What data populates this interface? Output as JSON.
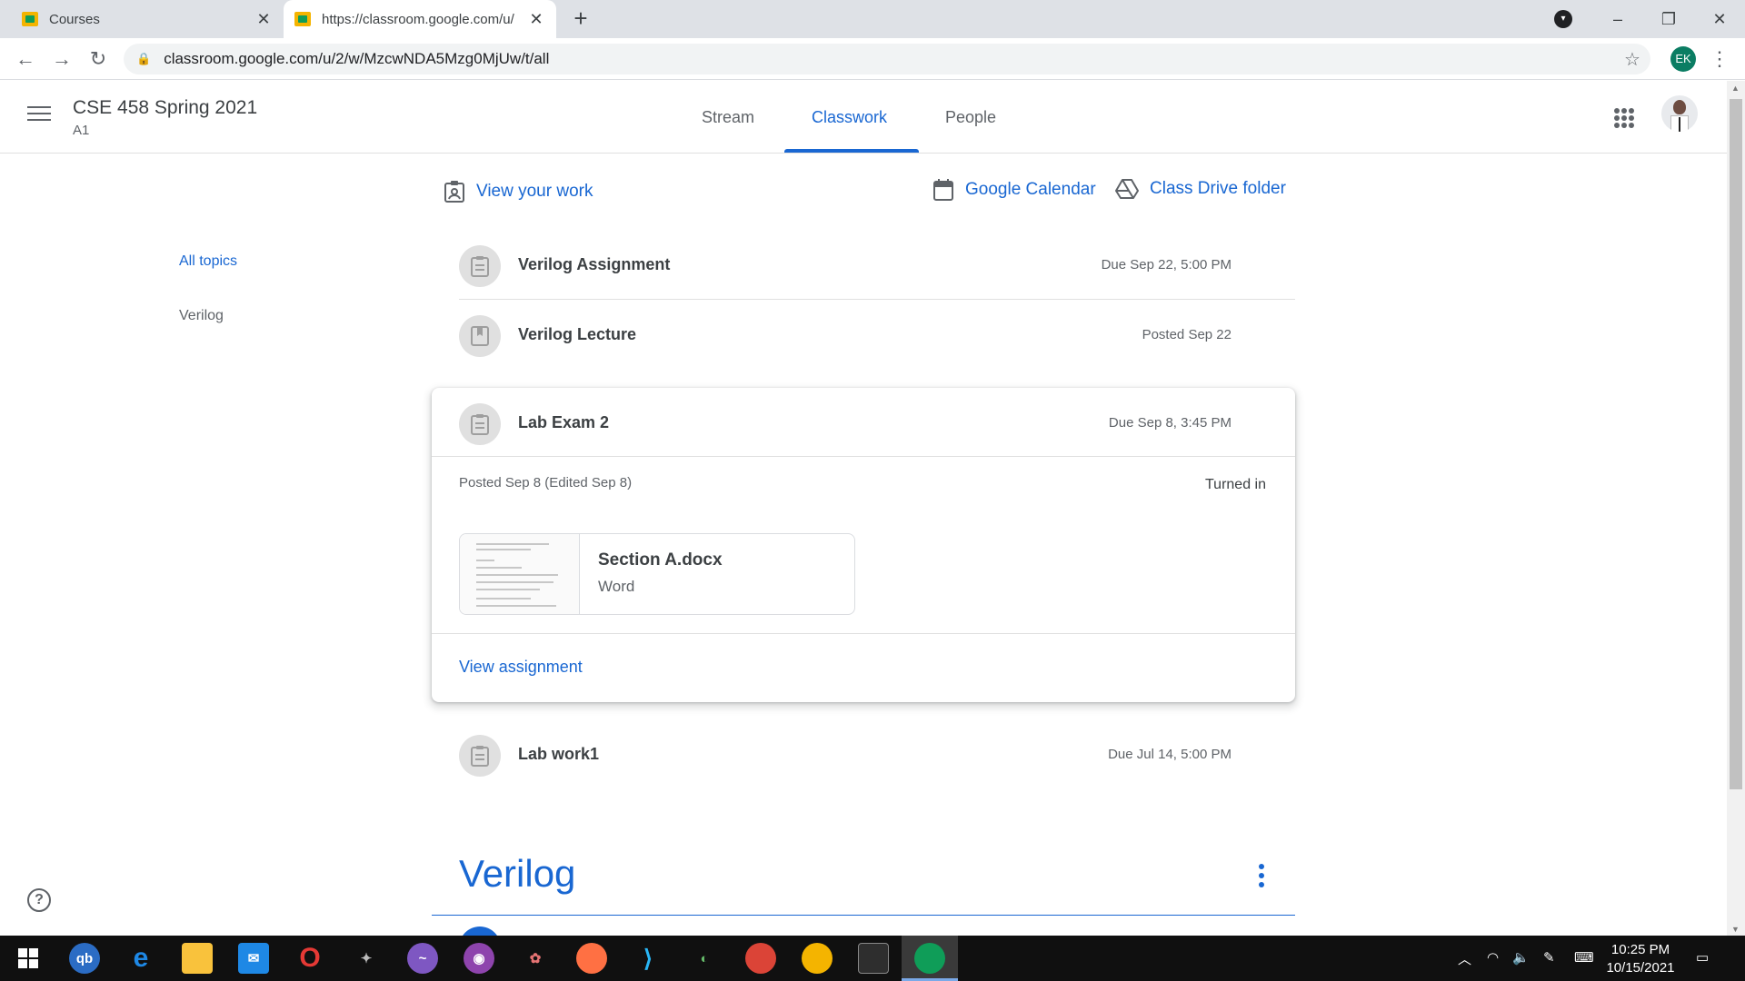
{
  "browser": {
    "tabs": [
      {
        "title": "Courses"
      },
      {
        "title": "https://classroom.google.com/u/"
      }
    ],
    "new_tab": "+",
    "url": "classroom.google.com/u/2/w/MzcwNDA5Mzg0MjUw/t/all",
    "profile_initials": "EK",
    "window_controls": [
      "–",
      "❐",
      "✕"
    ]
  },
  "course": {
    "title": "CSE 458 Spring 2021",
    "section": "A1"
  },
  "nav_tabs": [
    {
      "label": "Stream",
      "active": false
    },
    {
      "label": "Classwork",
      "active": true
    },
    {
      "label": "People",
      "active": false
    }
  ],
  "topics": {
    "all": "All topics",
    "items": [
      "Verilog"
    ]
  },
  "links": {
    "view_work": "View your work",
    "calendar": "Google Calendar",
    "drive": "Class Drive folder"
  },
  "items": [
    {
      "title": "Verilog Assignment",
      "date": "Due Sep 22, 5:00 PM",
      "icon": "assignment-icon"
    },
    {
      "title": "Verilog Lecture",
      "date": "Posted Sep 22",
      "icon": "material-icon"
    },
    {
      "title": "Lab Exam 2",
      "date": "Due Sep 8, 3:45 PM",
      "icon": "assignment-icon"
    },
    {
      "title": "Lab work1",
      "date": "Due Jul 14, 5:00 PM",
      "icon": "assignment-icon"
    }
  ],
  "expanded": {
    "posted": "Posted Sep 8 (Edited Sep 8)",
    "status": "Turned in",
    "attachment": {
      "name": "Section A.docx",
      "type": "Word"
    },
    "view_link": "View assignment"
  },
  "section": {
    "title": "Verilog"
  },
  "taskbar": {
    "time": "10:25 PM",
    "date": "10/15/2021"
  },
  "colors": {
    "accent": "#1967d2",
    "muted": "#5f6368"
  }
}
